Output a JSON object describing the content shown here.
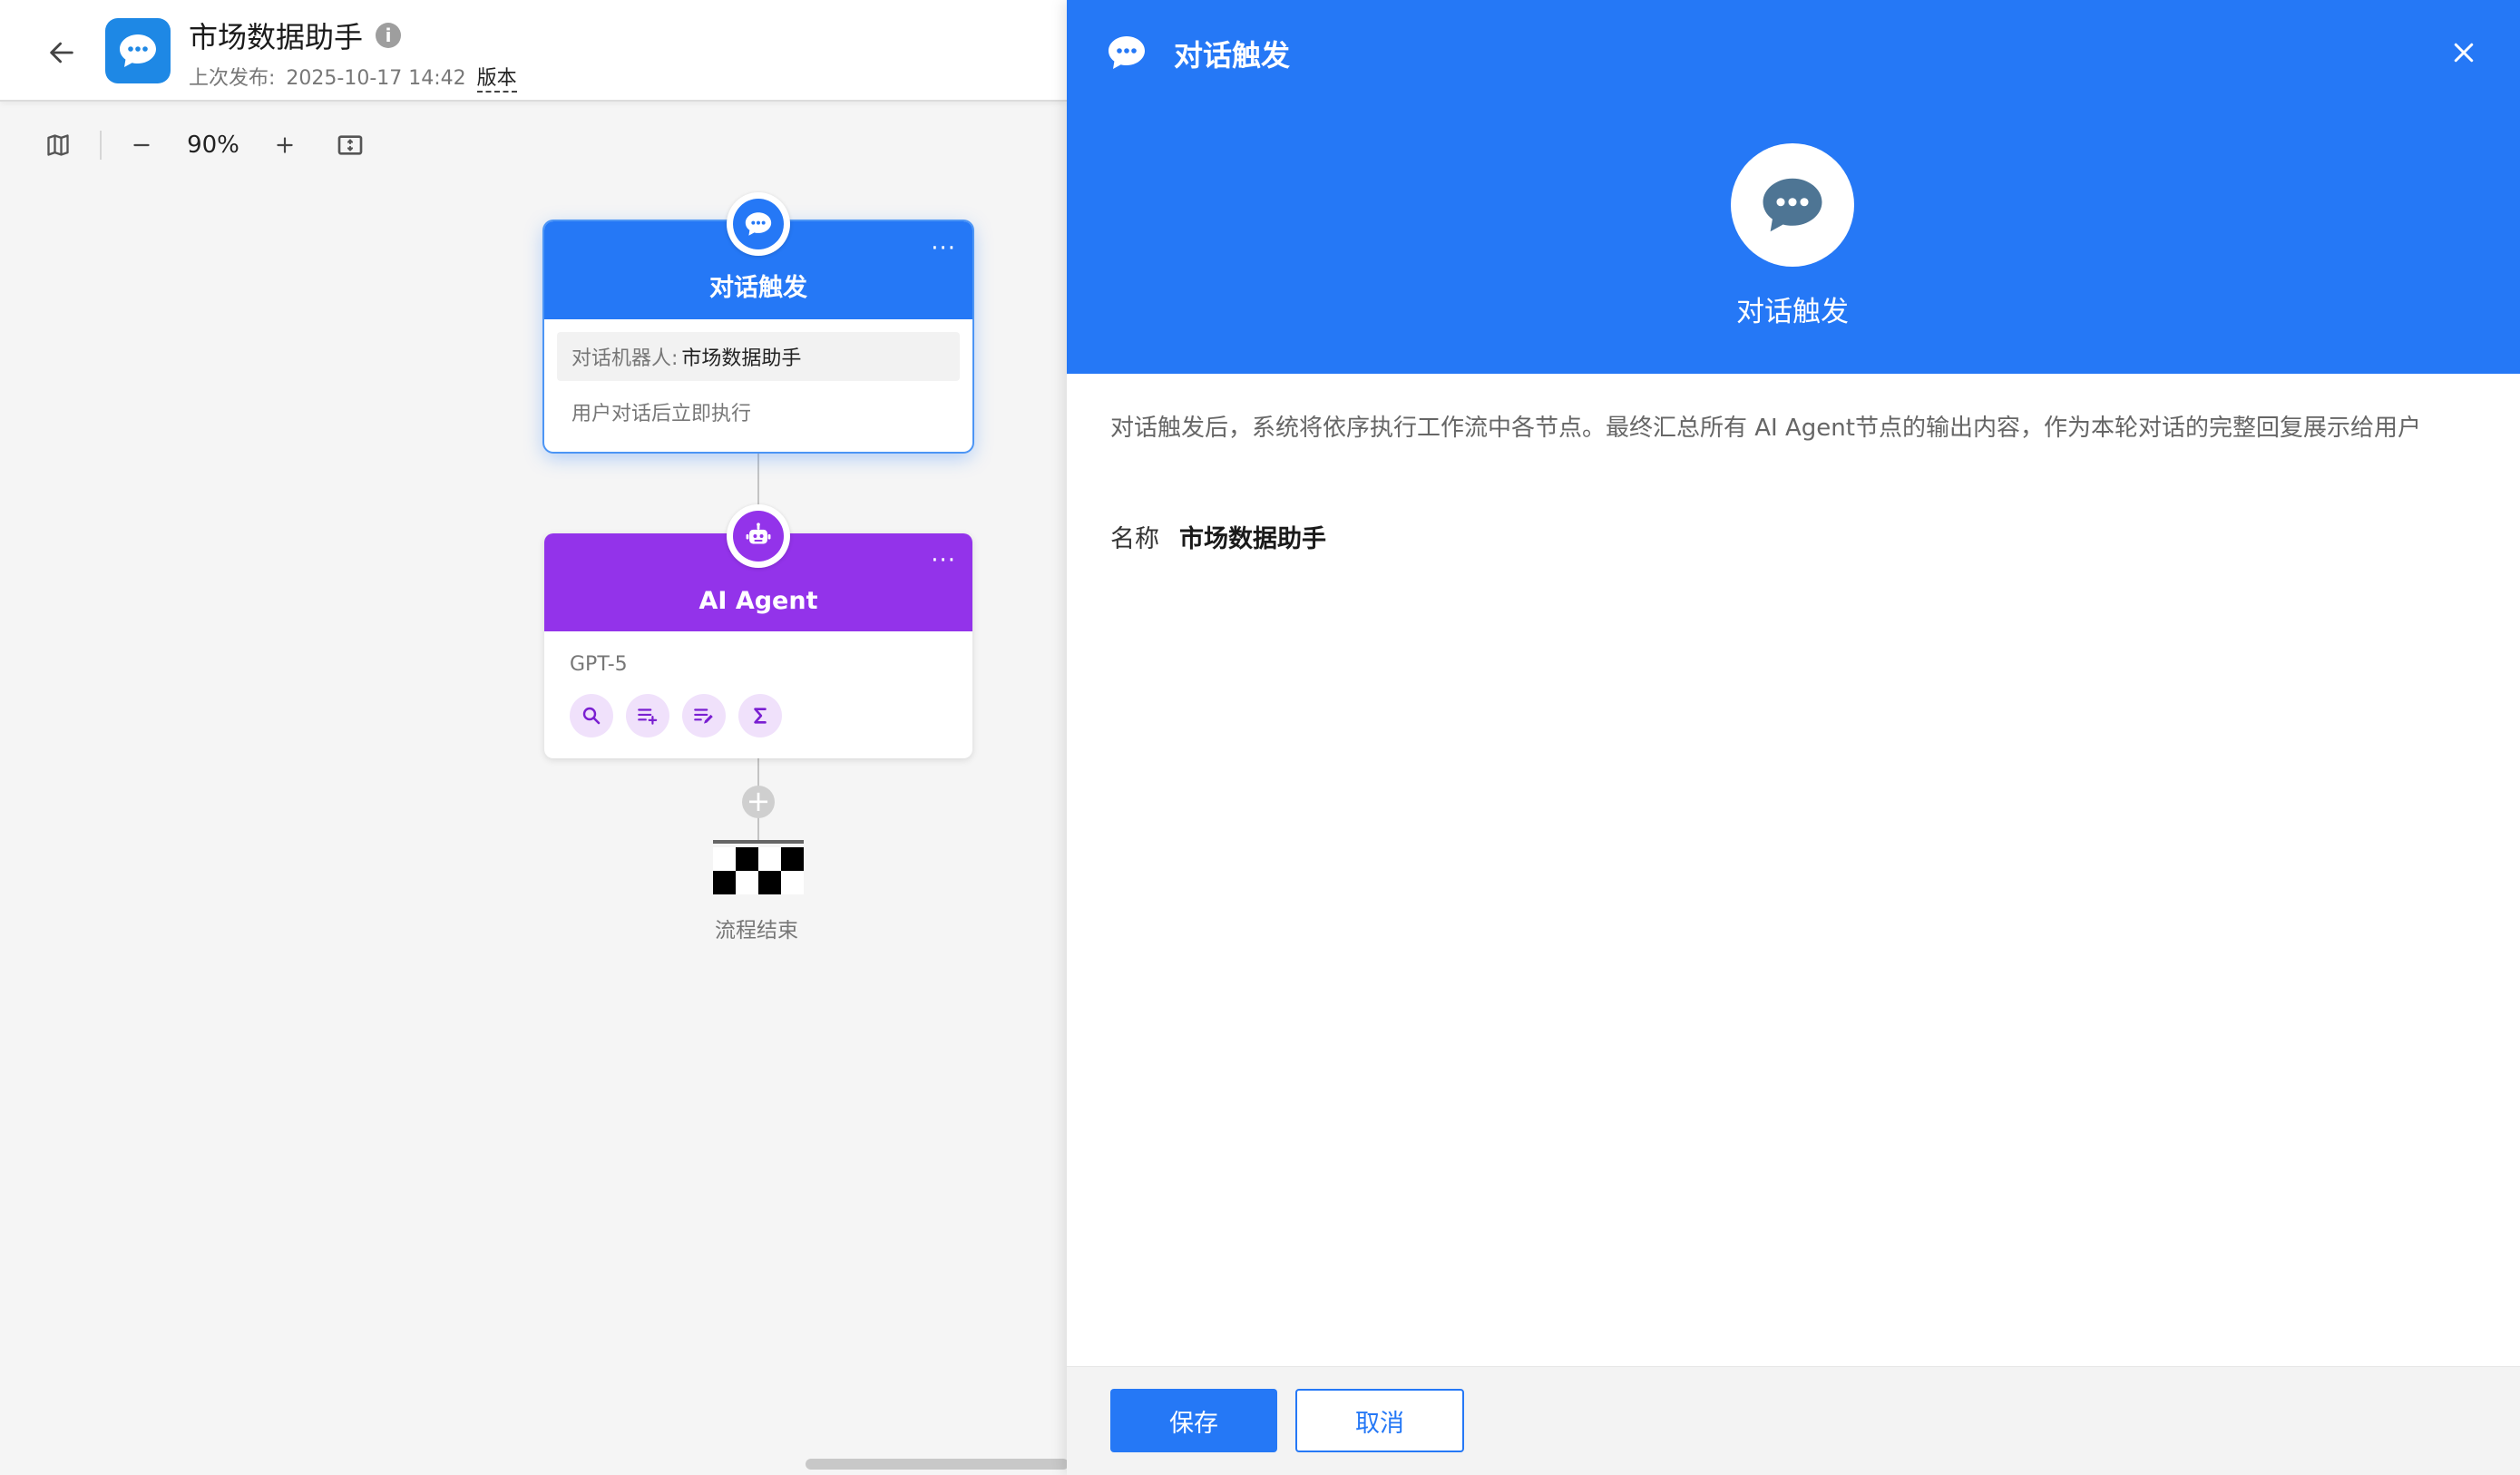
{
  "header": {
    "back_icon": "arrow-left-icon",
    "app_icon": "chat-bubble-icon",
    "title": "市场数据助手",
    "info_icon": "info-icon",
    "publish_prefix": "上次发布:",
    "publish_time": "2025-10-17 14:42",
    "version_link": "版本"
  },
  "toolbar": {
    "map_icon": "map-icon",
    "zoom_out_icon": "minus-icon",
    "zoom_level": "90%",
    "zoom_in_icon": "plus-icon",
    "fit_icon": "fit-screen-icon"
  },
  "canvas": {
    "trigger_node": {
      "title": "对话触发",
      "more": "···",
      "bot_label": "对话机器人:",
      "bot_value": "市场数据助手",
      "description": "用户对话后立即执行"
    },
    "agent_node": {
      "title": "AI Agent",
      "more": "···",
      "model": "GPT-5",
      "tools": [
        "search-icon",
        "list-add-icon",
        "list-edit-icon",
        "sigma-icon"
      ]
    },
    "end_label": "流程结束"
  },
  "panel": {
    "title": "对话触发",
    "hero_label": "对话触发",
    "description": "对话触发后，系统将依序执行工作流中各节点。最终汇总所有 AI Agent节点的输出内容，作为本轮对话的完整回复展示给用户",
    "name_label": "名称",
    "name_value": "市场数据助手",
    "save_label": "保存",
    "cancel_label": "取消"
  },
  "colors": {
    "primary": "#2578f6",
    "agent": "#9333ea",
    "app_icon": "#1e88e5"
  }
}
